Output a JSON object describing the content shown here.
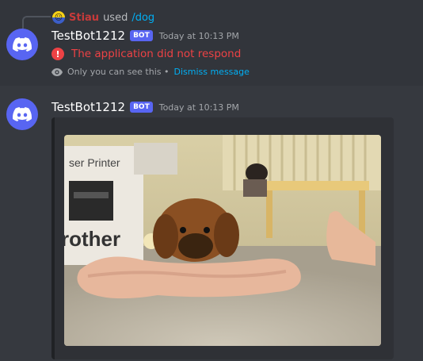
{
  "reply": {
    "username": "Stiau",
    "used_text": "used",
    "command": "/dog"
  },
  "message1": {
    "username": "TestBot1212",
    "bot_tag": "BOT",
    "timestamp": "Today at 10:13 PM",
    "error_text": "The application did not respond",
    "ephemeral_note": "Only you can see this •",
    "dismiss_label": "Dismiss message"
  },
  "message2": {
    "username": "TestBot1212",
    "bot_tag": "BOT",
    "timestamp": "Today at 10:13 PM",
    "embed_image": {
      "printer_box_text_top": "ser Printer",
      "printer_box_text_brand": "rother"
    }
  },
  "colors": {
    "background": "#36393f",
    "highlight": "#32353b",
    "blurple": "#5865f2",
    "error": "#ed4245",
    "link": "#00aff4"
  },
  "icons": {
    "avatar": "discord-logo-icon",
    "error": "exclamation-circle-icon",
    "eye": "eye-icon"
  }
}
